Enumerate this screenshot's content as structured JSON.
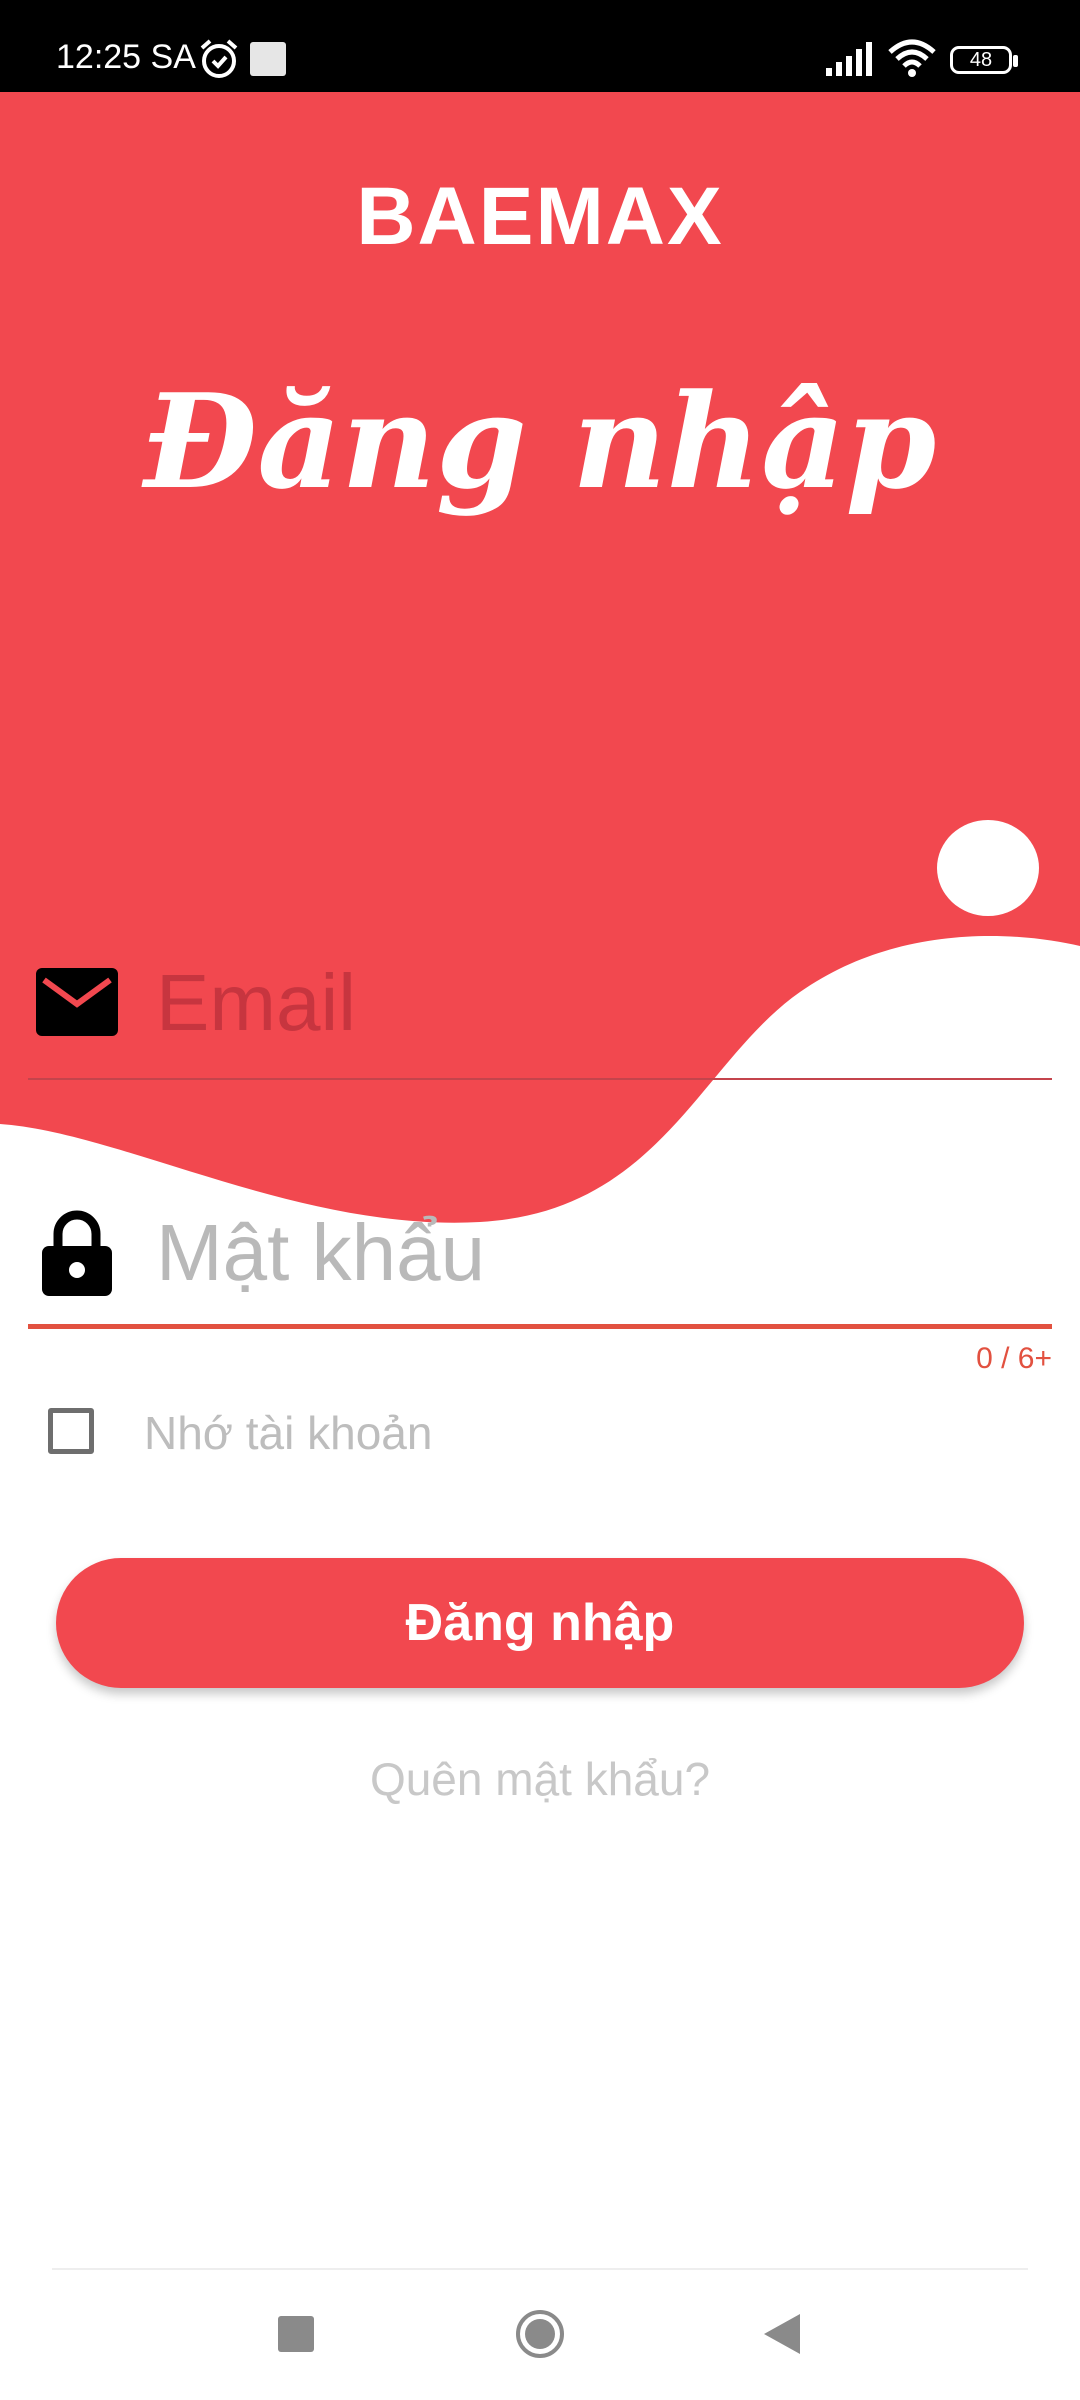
{
  "status_bar": {
    "time": "12:25 SA",
    "battery": "48",
    "icons": [
      "alarm-icon",
      "notification-icon",
      "signal-icon",
      "wifi-icon",
      "battery-icon"
    ]
  },
  "hero": {
    "brand": "BAEMAX",
    "title": "Đăng nhập",
    "background_color": "#f2484f"
  },
  "form": {
    "email": {
      "placeholder": "Email",
      "value": "",
      "icon": "mail-icon"
    },
    "password": {
      "placeholder": "Mật khẩu",
      "value": "",
      "icon": "lock-icon",
      "counter": "0 / 6+"
    },
    "remember": {
      "label": "Nhớ tài khoản",
      "checked": false
    },
    "login_button": "Đăng nhập",
    "forgot_password": "Quên mật khẩu?"
  },
  "nav_bar": {
    "buttons": [
      "recents-button",
      "home-button",
      "back-button"
    ]
  },
  "colors": {
    "accent": "#f2484f",
    "error_underline": "#e25140",
    "placeholder": "#b9b9b9"
  }
}
